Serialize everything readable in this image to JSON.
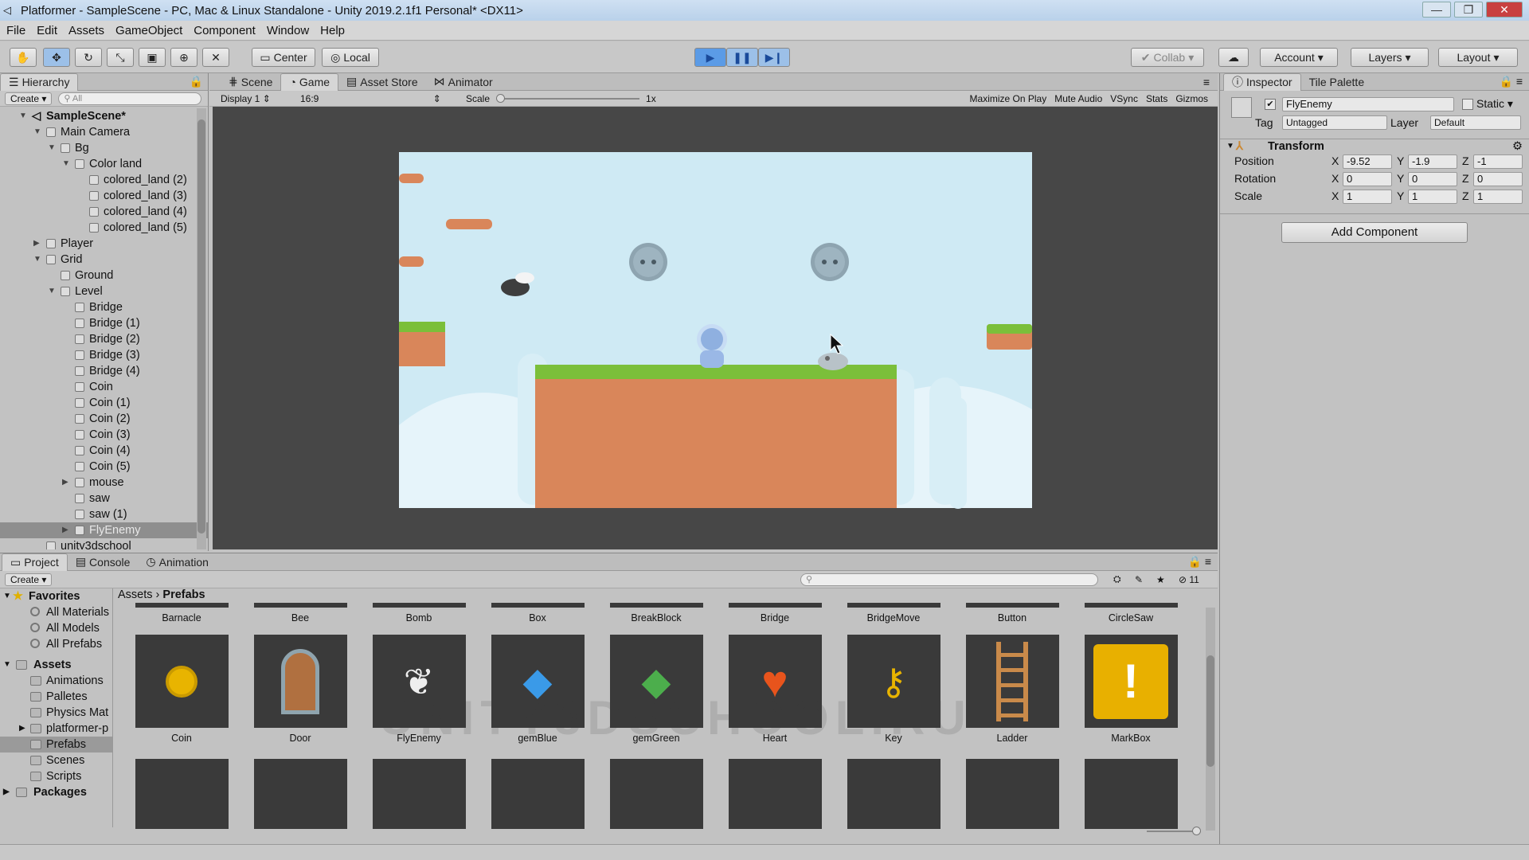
{
  "window": {
    "title": "Platformer - SampleScene - PC, Mac & Linux Standalone - Unity 2019.2.1f1 Personal* <DX11>"
  },
  "menu": [
    "File",
    "Edit",
    "Assets",
    "GameObject",
    "Component",
    "Window",
    "Help"
  ],
  "toolbar": {
    "center": "Center",
    "local": "Local",
    "collab": "Collab",
    "account": "Account",
    "layers": "Layers",
    "layout": "Layout"
  },
  "hierarchy": {
    "tab": "Hierarchy",
    "create": "Create",
    "search_placeholder": "All",
    "items": [
      {
        "label": "SampleScene*",
        "indent": 0,
        "arrow": "down",
        "bold": true
      },
      {
        "label": "Main Camera",
        "indent": 1,
        "arrow": "down"
      },
      {
        "label": "Bg",
        "indent": 2,
        "arrow": "down"
      },
      {
        "label": "Color land",
        "indent": 3,
        "arrow": "down"
      },
      {
        "label": "colored_land (2)",
        "indent": 4
      },
      {
        "label": "colored_land (3)",
        "indent": 4
      },
      {
        "label": "colored_land (4)",
        "indent": 4
      },
      {
        "label": "colored_land (5)",
        "indent": 4
      },
      {
        "label": "Player",
        "indent": 1,
        "arrow": "right"
      },
      {
        "label": "Grid",
        "indent": 1,
        "arrow": "down"
      },
      {
        "label": "Ground",
        "indent": 2
      },
      {
        "label": "Level",
        "indent": 2,
        "arrow": "down"
      },
      {
        "label": "Bridge",
        "indent": 3
      },
      {
        "label": "Bridge (1)",
        "indent": 3
      },
      {
        "label": "Bridge (2)",
        "indent": 3
      },
      {
        "label": "Bridge (3)",
        "indent": 3
      },
      {
        "label": "Bridge (4)",
        "indent": 3
      },
      {
        "label": "Coin",
        "indent": 3
      },
      {
        "label": "Coin (1)",
        "indent": 3
      },
      {
        "label": "Coin (2)",
        "indent": 3
      },
      {
        "label": "Coin (3)",
        "indent": 3
      },
      {
        "label": "Coin (4)",
        "indent": 3
      },
      {
        "label": "Coin (5)",
        "indent": 3
      },
      {
        "label": "mouse",
        "indent": 3,
        "arrow": "right"
      },
      {
        "label": "saw",
        "indent": 3
      },
      {
        "label": "saw (1)",
        "indent": 3
      },
      {
        "label": "FlyEnemy",
        "indent": 3,
        "arrow": "right",
        "selected": true
      },
      {
        "label": "unity3dschool",
        "indent": 1
      }
    ]
  },
  "game": {
    "tabs": [
      "Scene",
      "Game",
      "Asset Store",
      "Animator"
    ],
    "display": "Display 1",
    "aspect": "16:9",
    "scale_label": "Scale",
    "scale_value": "1x",
    "buttons": [
      "Maximize On Play",
      "Mute Audio",
      "VSync",
      "Stats",
      "Gizmos"
    ]
  },
  "inspector": {
    "tabs": [
      "Inspector",
      "Tile Palette"
    ],
    "object_name": "FlyEnemy",
    "static_label": "Static",
    "tag_label": "Tag",
    "tag": "Untagged",
    "layer_label": "Layer",
    "layer": "Default",
    "component": "Transform",
    "rows": [
      {
        "label": "Position",
        "x": "-9.52",
        "y": "-1.9",
        "z": "-1"
      },
      {
        "label": "Rotation",
        "x": "0",
        "y": "0",
        "z": "0"
      },
      {
        "label": "Scale",
        "x": "1",
        "y": "1",
        "z": "1"
      }
    ],
    "add_component": "Add Component"
  },
  "project": {
    "tabs": [
      "Project",
      "Console",
      "Animation"
    ],
    "create": "Create",
    "hidden_count": "11",
    "breadcrumb": [
      "Assets",
      "Prefabs"
    ],
    "favorites_label": "Favorites",
    "favorites": [
      "All Materials",
      "All Models",
      "All Prefabs"
    ],
    "assets_label": "Assets",
    "folders": [
      "Animations",
      "Palletes",
      "Physics Mat",
      "platformer-p",
      "Prefabs",
      "Scenes",
      "Scripts"
    ],
    "packages_label": "Packages",
    "row0": [
      "Barnacle",
      "Bee",
      "Bomb",
      "Box",
      "BreakBlock",
      "Bridge",
      "BridgeMove",
      "Button",
      "CircleSaw"
    ],
    "row1": [
      "Coin",
      "Door",
      "FlyEnemy",
      "gemBlue",
      "gemGreen",
      "Heart",
      "Key",
      "Ladder",
      "MarkBox"
    ],
    "watermark": "UNITY3DSCHOOL.RU"
  },
  "colors": {
    "accent": "#3d80d6",
    "selection": "#8e8e8e",
    "sky": "#cfeaf4",
    "dirt": "#d9865a",
    "grass": "#7bbf3a"
  }
}
